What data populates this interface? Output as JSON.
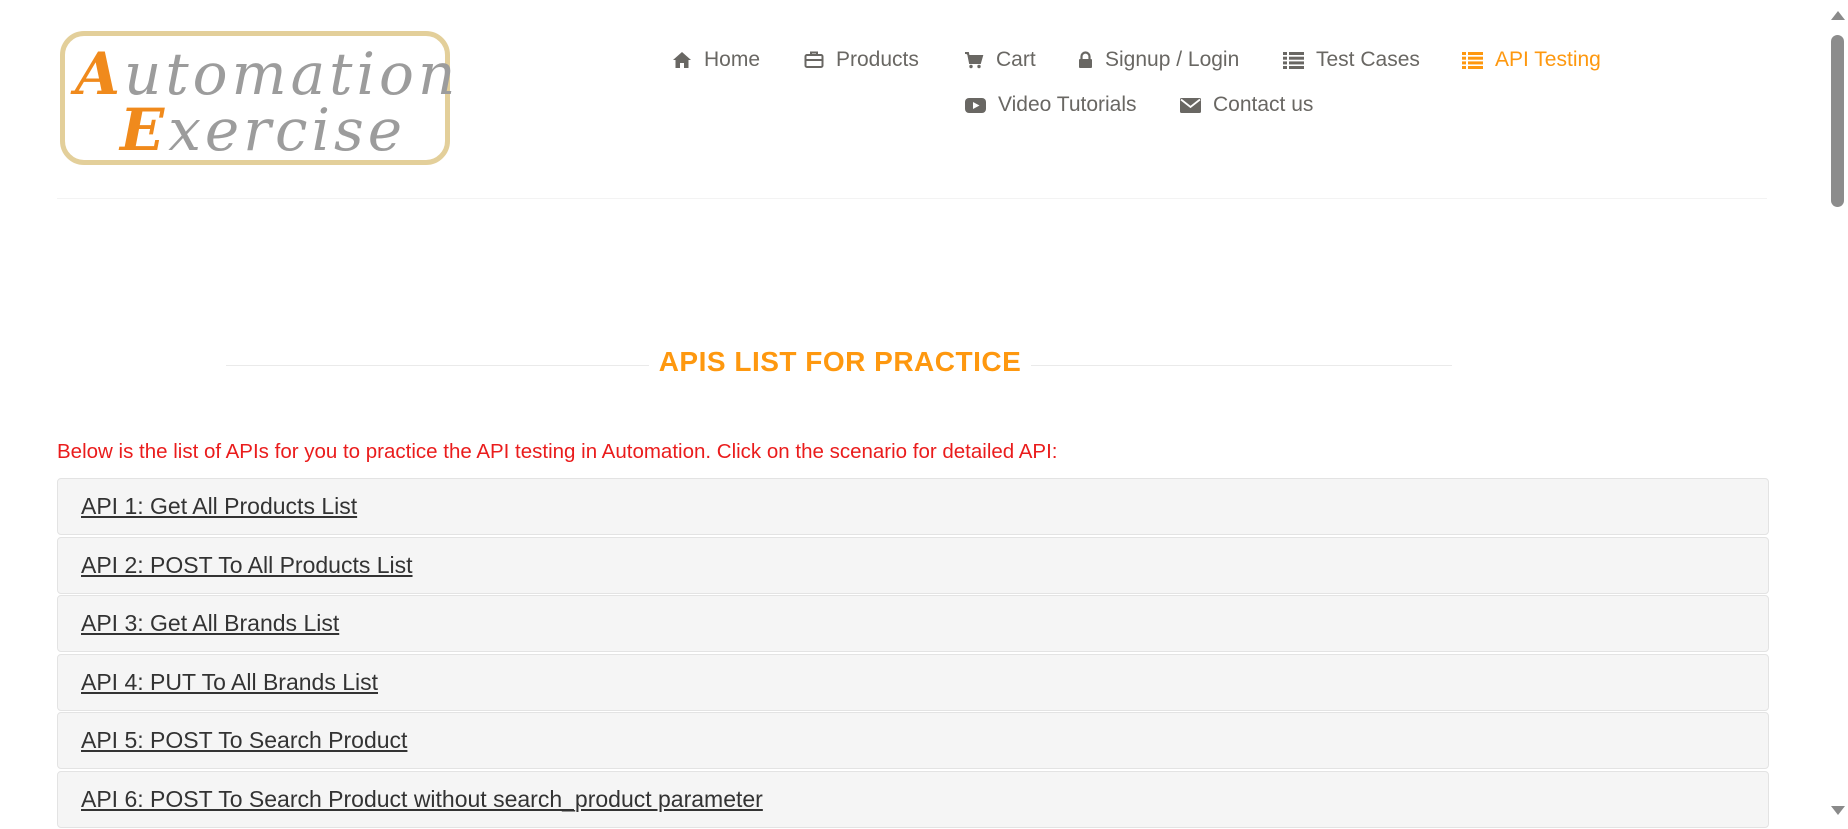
{
  "logo": {
    "line1_cap": "A",
    "line1_rest": "utomation",
    "line2_cap": "E",
    "line2_rest": "xercise"
  },
  "nav": {
    "items": [
      {
        "label": "Home",
        "icon": "home-icon"
      },
      {
        "label": "Products",
        "icon": "briefcase-icon"
      },
      {
        "label": "Cart",
        "icon": "cart-icon"
      },
      {
        "label": "Signup / Login",
        "icon": "lock-icon"
      },
      {
        "label": "Test Cases",
        "icon": "list-icon"
      },
      {
        "label": "API Testing",
        "icon": "list-icon",
        "active": true
      },
      {
        "label": "Video Tutorials",
        "icon": "youtube-play-icon"
      },
      {
        "label": "Contact us",
        "icon": "envelope-icon"
      }
    ]
  },
  "main": {
    "title": "APIS LIST FOR PRACTICE",
    "intro": "Below is the list of APIs for you to practice the API testing in Automation. Click on the scenario for detailed API:",
    "apis": [
      "API 1: Get All Products List",
      "API 2: POST To All Products List",
      "API 3: Get All Brands List",
      "API 4: PUT To All Brands List",
      "API 5: POST To Search Product",
      "API 6: POST To Search Product without search_product parameter"
    ]
  },
  "colors": {
    "accent": "#fe980f",
    "intro_text": "#ea1c1c",
    "nav_text": "#696763",
    "row_bg": "#f5f5f5"
  }
}
